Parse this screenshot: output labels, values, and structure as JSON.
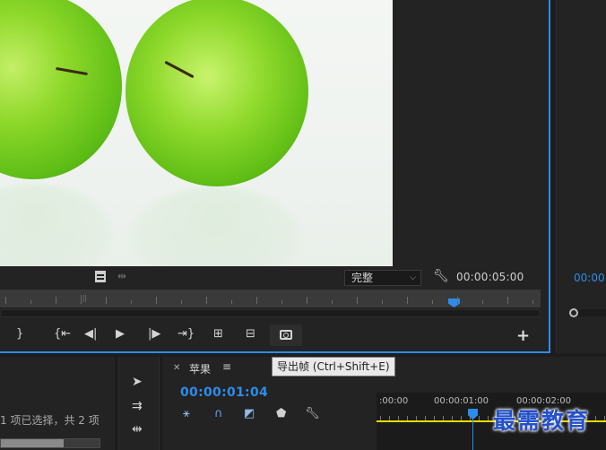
{
  "source_monitor": {
    "resolution": "完整",
    "duration": "00:00:05:00",
    "tooltip": "导出帧 (Ctrl+Shift+E)"
  },
  "program_monitor": {
    "timecode": "00:00"
  },
  "project": {
    "status": "1 项已选择，共 2 项",
    "scroll_fraction": 0.64
  },
  "timeline": {
    "sequence_name": "苹果",
    "timecode": "00:00:01:04",
    "ruler": [
      ":00:00",
      "00:00:01:00",
      "00:00:02:00"
    ]
  },
  "watermark": "最需教育",
  "colors": {
    "accent": "#2d8ceb",
    "in_out_bar": "#e8d900"
  }
}
